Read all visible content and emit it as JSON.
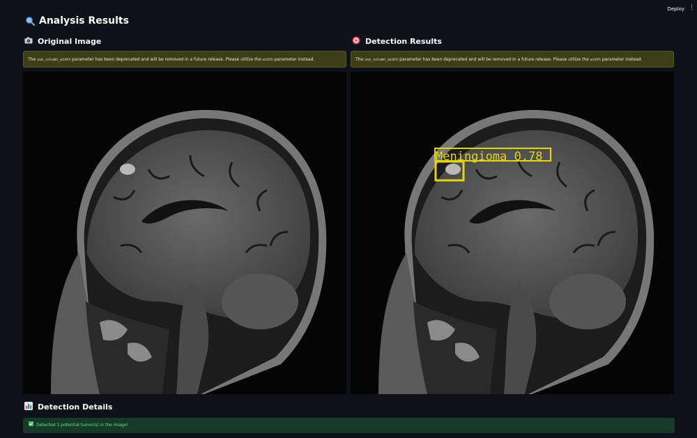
{
  "toolbar": {
    "deploy_label": "Deploy",
    "menu_icon": "kebab-menu-icon"
  },
  "header": {
    "title": "Analysis Results",
    "icon": "magnifier-icon"
  },
  "original": {
    "title": "Original Image",
    "icon": "camera-icon",
    "warning_pre": "The ",
    "warning_code1": "use_column_width",
    "warning_mid": " parameter has been deprecated and will be removed in a future release. Please utilize the ",
    "warning_code2": "width",
    "warning_post": " parameter instead."
  },
  "detection": {
    "title": "Detection Results",
    "icon": "target-icon",
    "warning_pre": "The ",
    "warning_code1": "use_column_width",
    "warning_mid": " parameter has been deprecated and will be removed in a future release. Please utilize the ",
    "warning_code2": "width",
    "warning_post": " parameter instead.",
    "box_label": "Meningioma  0.78",
    "box_color": "#e5d50c"
  },
  "details": {
    "title": "Detection Details",
    "icon": "bar-chart-icon",
    "success_text": "Detected 1 potential tumor(s) in the image!",
    "success_icon": "check-icon"
  },
  "colors": {
    "background": "#0e1117",
    "warning_bg": "#3d3e18",
    "success_bg": "#173928",
    "success_text": "#5ae38e"
  }
}
